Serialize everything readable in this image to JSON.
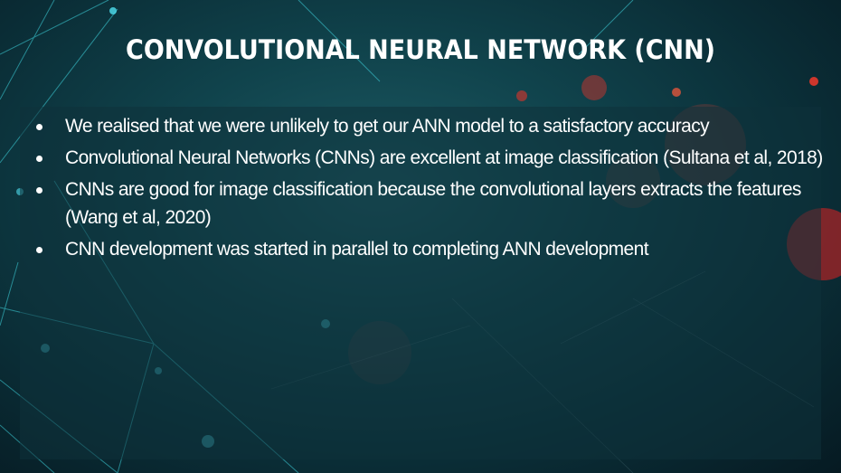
{
  "slide": {
    "title": "CONVOLUTIONAL NEURAL NETWORK (CNN)",
    "bullets": [
      "We realised that we were unlikely to get our ANN model to a satisfactory accuracy",
      "Convolutional Neural Networks (CNNs) are excellent at image classification (Sultana et al, 2018)",
      "CNNs are good for image classification because the convolutional layers extracts the features (Wang et al, 2020)",
      "CNN development was started in parallel to completing ANN development"
    ]
  },
  "colors": {
    "background": "#10434c",
    "accent_lines": "#3fd6e0",
    "bokeh_red": "#e0342a",
    "text": "#ffffff"
  }
}
